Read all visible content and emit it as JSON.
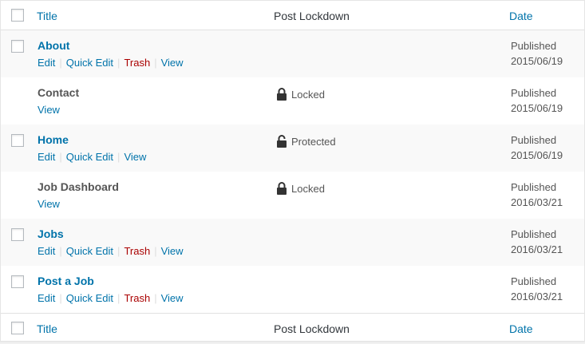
{
  "columns": {
    "title": "Title",
    "lockdown": "Post Lockdown",
    "date": "Date"
  },
  "actions": {
    "edit": "Edit",
    "quick_edit": "Quick Edit",
    "trash": "Trash",
    "view": "View"
  },
  "rows": [
    {
      "title": "About",
      "lock": "",
      "date_status": "Published",
      "date": "2015/06/19"
    },
    {
      "title": "Contact",
      "lock": "Locked",
      "date_status": "Published",
      "date": "2015/06/19"
    },
    {
      "title": "Home",
      "lock": "Protected",
      "date_status": "Published",
      "date": "2015/06/19"
    },
    {
      "title": "Job Dashboard",
      "lock": "Locked",
      "date_status": "Published",
      "date": "2016/03/21"
    },
    {
      "title": "Jobs",
      "lock": "",
      "date_status": "Published",
      "date": "2016/03/21"
    },
    {
      "title": "Post a Job",
      "lock": "",
      "date_status": "Published",
      "date": "2016/03/21"
    }
  ],
  "icons": {
    "lock": "lock-icon",
    "unlock": "unlocked-icon"
  },
  "colors": {
    "link": "#0073aa",
    "trash": "#a00000",
    "alt_row": "#f9f9f9"
  }
}
